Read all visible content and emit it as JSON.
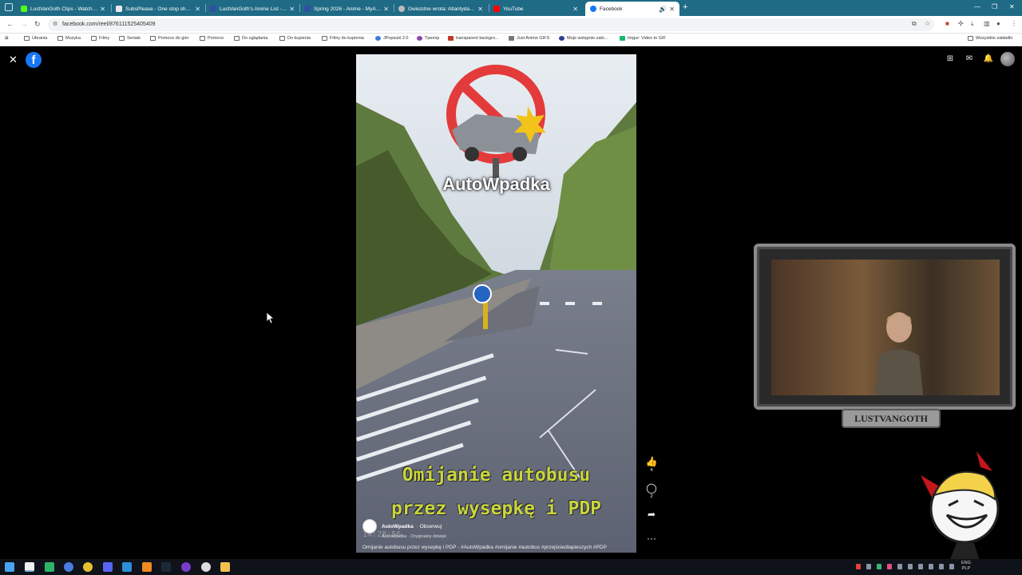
{
  "browser": {
    "tabs": [
      {
        "title": "LustVanGoth Clips - Watch Live",
        "favicon_color": "#53fc18"
      },
      {
        "title": "SubsPlease - One stop shop fo",
        "favicon_color": "#e9e9e9"
      },
      {
        "title": "LustVanGoth's Anime List - My",
        "favicon_color": "#2e51a2"
      },
      {
        "title": "Spring 2026 - Anime - MyAnim",
        "favicon_color": "#2e51a2"
      },
      {
        "title": "Gwiezdne wrota: Atlantyda / St",
        "favicon_color": "#bbbbbb"
      },
      {
        "title": "YouTube",
        "favicon_color": "#ff0000"
      },
      {
        "title": "Facebook",
        "favicon_color": "#1877f2",
        "active": true
      }
    ],
    "url": "facebook.com/reel/876111525405409",
    "bookmarks": [
      "Ubrania",
      "Muzyka",
      "Filmy",
      "Seriale",
      "Pomoce do gier",
      "Pomoce",
      "Do oglądania",
      "Do kupienia",
      "Filmy do kupienia",
      "JPopsuki 2.0",
      "Tpeexp",
      "transparent backgro...",
      "Just Anime GIFS",
      "Moje wstępnie zało...",
      "Imgur: Video to GIF"
    ],
    "all_bookmarks_label": "Wszystkie zakładki"
  },
  "reel": {
    "brand_text": "AutoWpadka",
    "caption_line1": "Omijanie autobusu",
    "caption_line2": "przez wysepkę i PDP",
    "author_name": "AutoWpadka",
    "follow_label": "· Obserwuj",
    "audio": "AutoWpadka · Oryginalny dźwięk",
    "description": "Omijanie autobusu przez wysepkę i PDP - #AutoWpadka #omijanie #autobus #przejściedlapieszych #PDP",
    "timestamp_overlay": "14:28:56",
    "likes": "4",
    "comments": "2",
    "more_label": "···"
  },
  "overlay": {
    "streamer_name": "LUSTVANGOTH"
  },
  "taskbar": {
    "lang_top": "ENG",
    "lang_bottom": "PLP"
  },
  "colors": {
    "tabbar": "#1f6a85",
    "facebook_blue": "#1877f2",
    "caption_yellow": "#c9d63a"
  }
}
